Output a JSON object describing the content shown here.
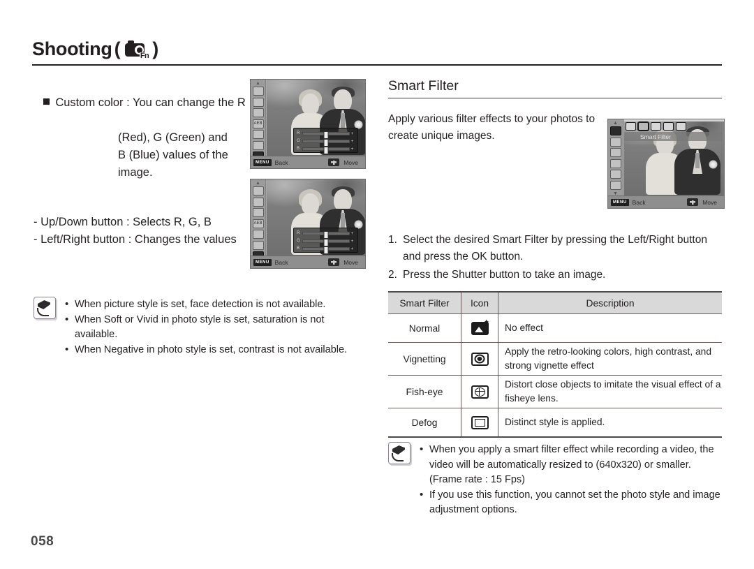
{
  "header": {
    "title": "Shooting",
    "open_paren": "(",
    "close_paren": ")",
    "icon_name": "camera-fn-icon",
    "fn_label": "Fn"
  },
  "left_column": {
    "custom_color": {
      "label": "Custom color :",
      "lines": [
        "You can change the R",
        "(Red), G (Green) and",
        "B (Blue) values of the",
        "image."
      ]
    },
    "button_hints": [
      "- Up/Down button : Selects R, G, B",
      "- Left/Right button : Changes the values"
    ],
    "note": {
      "icon_name": "note-pen-icon",
      "items": [
        [
          "When picture style is set, face detection is not available."
        ],
        [
          "When Soft or Vivid in photo style is set, saturation is not",
          "available."
        ],
        [
          "When Negative in photo style is set, contrast is not available."
        ]
      ]
    }
  },
  "lcd_screens": {
    "custom_color_1": {
      "sidebar_icons": [
        "scroll-up-arrow-icon",
        "face-detect-icon",
        "focus-area-icon",
        "image-size-icon",
        "aeb-icon",
        "grid-icon",
        "flash-exposure-icon",
        "photo-style-icon",
        "scroll-down-arrow-icon"
      ],
      "aeb_label": "AEB",
      "selected_sidebar_index": 7,
      "sliders": [
        {
          "label": "R",
          "value": 0,
          "plus": "+"
        },
        {
          "label": "G",
          "value": 0,
          "plus": "+"
        },
        {
          "label": "B",
          "value": 0,
          "plus": "+"
        }
      ],
      "bottom_bar": {
        "menu_chip": "MENU",
        "back_label": "Back",
        "dpad_icon": "dpad-icon",
        "move_label": "Move"
      }
    },
    "custom_color_2": {
      "sidebar_icons": [
        "scroll-up-arrow-icon",
        "face-detect-icon",
        "focus-area-icon",
        "image-size-icon",
        "aeb-icon",
        "grid-icon",
        "flash-exposure-icon",
        "photo-style-icon",
        "scroll-down-arrow-icon"
      ],
      "aeb_label": "AEB",
      "selected_sidebar_index": 7,
      "sliders": [
        {
          "label": "R",
          "value": 0,
          "plus": "+"
        },
        {
          "label": "G",
          "value": 0,
          "plus": "+"
        },
        {
          "label": "B",
          "value": 0,
          "plus": "+"
        }
      ],
      "bottom_bar": {
        "menu_chip": "MENU",
        "back_label": "Back",
        "dpad_icon": "dpad-icon",
        "move_label": "Move"
      }
    },
    "smart_filter": {
      "filter_strip_icons": [
        "normal-filter-icon",
        "vignetting-filter-icon",
        "fisheye-filter-icon",
        "defog-filter-icon",
        "extra-filter-icon"
      ],
      "selected_filter_index": 1,
      "menu_label": "Smart Filter",
      "sidebar_icons": [
        "scroll-up-arrow-icon",
        "smart-filter-icon",
        "photo-style-icon",
        "image-adjust-icon",
        "voice-memo-icon",
        "sharpness-icon",
        "grid-icon",
        "scroll-down-arrow-icon"
      ],
      "bottom_bar": {
        "menu_chip": "MENU",
        "back_label": "Back",
        "dpad_icon": "dpad-icon",
        "move_label": "Move"
      }
    }
  },
  "right_column": {
    "section_title": "Smart Filter",
    "intro": "Apply various filter effects to your photos to create unique images.",
    "steps": [
      {
        "num": "1.",
        "text": "Select the desired Smart Filter by pressing the Left/Right button and press the OK button."
      },
      {
        "num": "2.",
        "text": "Press the Shutter button to take an image."
      }
    ],
    "table": {
      "headers": [
        "Smart Filter",
        "Icon",
        "Description"
      ],
      "rows": [
        {
          "name": "Normal",
          "icon": "normal-filter-icon",
          "description": "No effect"
        },
        {
          "name": "Vignetting",
          "icon": "vignetting-filter-icon",
          "description": "Apply the retro-looking colors, high contrast, and strong vignette effect"
        },
        {
          "name": "Fish-eye",
          "icon": "fisheye-filter-icon",
          "description": "Distort close objects to imitate the visual effect of a fisheye lens."
        },
        {
          "name": "Defog",
          "icon": "defog-filter-icon",
          "description": "Distinct style is applied."
        }
      ]
    },
    "note": {
      "icon_name": "note-pen-icon",
      "items": [
        [
          "When you apply a smart filter effect while recording a video, the",
          "video will be automatically resized to (640x320) or smaller.",
          "(Frame rate : 15 Fps)"
        ],
        [
          "If you use this function, you cannot set the photo style and image",
          "adjustment options."
        ]
      ]
    }
  },
  "page_number": "058"
}
